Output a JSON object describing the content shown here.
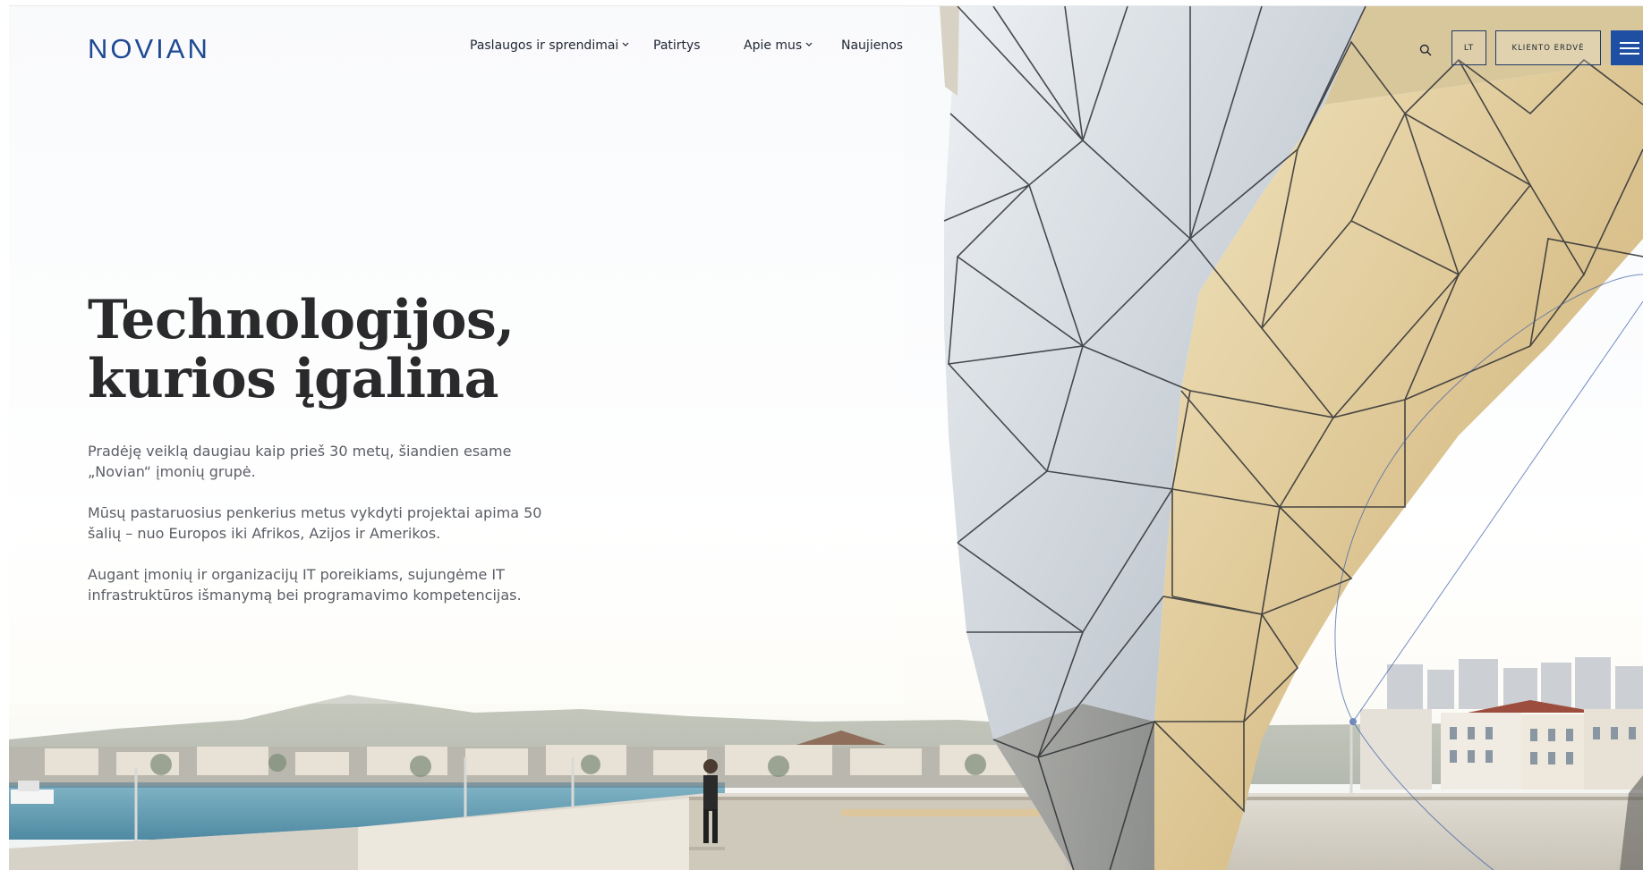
{
  "logo": {
    "text": "NOVIAN"
  },
  "nav": {
    "items": [
      {
        "label": "Paslaugos ir sprendimai",
        "has_dropdown": true
      },
      {
        "label": "Patirtys",
        "has_dropdown": false
      },
      {
        "label": "Apie mus",
        "has_dropdown": true
      },
      {
        "label": "Naujienos",
        "has_dropdown": false
      }
    ],
    "chevron": "⌄"
  },
  "header_actions": {
    "search_icon": "search-icon",
    "language": "LT",
    "client_area": "KLIENTO ERDVĖ",
    "menu_icon": "hamburger-menu-icon"
  },
  "hero": {
    "title_line1": "Technologijos,",
    "title_line2": "kurios įgalina",
    "paragraphs": [
      "Pradėję veiklą daugiau kaip prieš 30 metų, šiandien esame „Novian“ įmonių grupė.",
      "Mūsų pastaruosius penkerius metus vykdyti projektai apima 50 šalių – nuo Europos iki Afrikos, Azijos ir Amerikos.",
      "Augant įmonių ir organizacijų IT poreikiams, sujungėme IT infrastruktūros išmanymą bei programavimo kompetencijas."
    ]
  },
  "colors": {
    "brand_blue": "#1f4a93",
    "menu_button": "#1f4fa3",
    "heading": "#2a2a2d",
    "body_text": "#5b5e66"
  }
}
